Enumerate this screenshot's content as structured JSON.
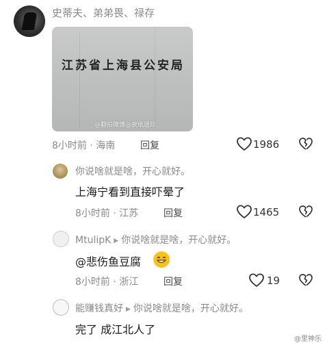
{
  "comments": [
    {
      "username": "史蒂夫、弟弟畏、禄存",
      "photo_text": "江苏省上海县公安局",
      "photo_watermark": "@翻拍微博@故纸遗珍",
      "time": "8小时前",
      "location": "海南",
      "reply_label": "回复",
      "likes": "1986"
    }
  ],
  "replies": [
    {
      "quote": "你说啥就是啥，开心就好。",
      "text": "上海宁看到直接吓晕了",
      "time": "8小时前",
      "location": "江苏",
      "reply_label": "回复",
      "likes": "1465"
    },
    {
      "username": "MtulipK",
      "quote": "你说啥就是啥，开心就好。",
      "text": "@悲伤鱼豆腐",
      "time": "8小时前",
      "location": "浙江",
      "reply_label": "回复",
      "likes": "19"
    },
    {
      "username": "能赚钱真好",
      "quote": "你说啥就是啥，开心就好。",
      "text": "完了 成江北人了"
    }
  ],
  "separator": "·",
  "footer_watermark": "@里神乐",
  "colors": {
    "meta_gray": "#8a8a8a",
    "text": "#1a1a1a"
  },
  "icons": {
    "like": "heart-outline-icon",
    "dislike": "broken-heart-icon",
    "arrow": "triangle-right-icon",
    "emoji": "grinning-face-emoji"
  }
}
